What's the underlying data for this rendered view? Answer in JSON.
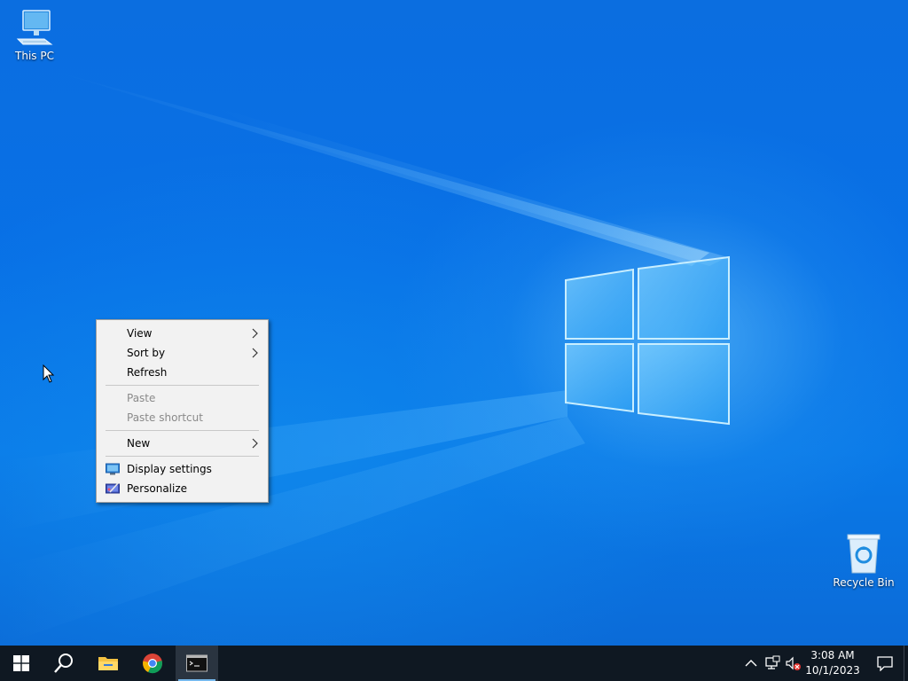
{
  "desktop": {
    "icons": [
      {
        "id": "this-pc",
        "label": "This PC",
        "icon": "computer-icon"
      },
      {
        "id": "recycle-bin",
        "label": "Recycle Bin",
        "icon": "recycle-bin-icon"
      }
    ]
  },
  "context_menu": {
    "items": [
      {
        "label": "View",
        "has_submenu": true,
        "enabled": true
      },
      {
        "label": "Sort by",
        "has_submenu": true,
        "enabled": true
      },
      {
        "label": "Refresh",
        "has_submenu": false,
        "enabled": true
      },
      {
        "label": "Paste",
        "has_submenu": false,
        "enabled": false
      },
      {
        "label": "Paste shortcut",
        "has_submenu": false,
        "enabled": false
      },
      {
        "label": "New",
        "has_submenu": true,
        "enabled": true
      },
      {
        "label": "Display settings",
        "icon": "display-settings-icon",
        "enabled": true
      },
      {
        "label": "Personalize",
        "icon": "personalize-icon",
        "enabled": true
      }
    ]
  },
  "taskbar": {
    "buttons": [
      {
        "name": "start",
        "icon": "windows-start-icon"
      },
      {
        "name": "search",
        "icon": "search-icon"
      },
      {
        "name": "file-explorer",
        "icon": "folder-icon"
      },
      {
        "name": "chrome",
        "icon": "chrome-icon"
      },
      {
        "name": "command-prompt",
        "icon": "terminal-icon",
        "active": true
      }
    ],
    "tray": {
      "icons": [
        "chevron-up-icon",
        "network-icon",
        "volume-muted-icon"
      ],
      "time": "3:08 AM",
      "date": "10/1/2023",
      "notification_icon": "notification-icon"
    }
  },
  "colors": {
    "wallpaper": "#0a6fe2",
    "taskbar": "#0f1822",
    "menu_bg": "#f2f2f2",
    "disabled_text": "#8a8a8a",
    "active_underline": "#76b9ed"
  }
}
